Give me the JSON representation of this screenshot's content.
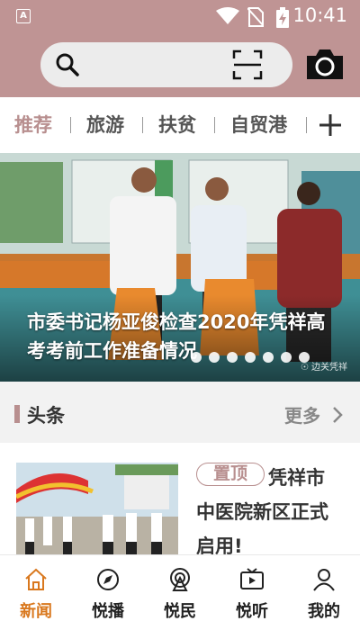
{
  "status_bar": {
    "time": "10:41",
    "app_indicator": "A"
  },
  "search": {
    "value": "",
    "placeholder": ""
  },
  "tabs": [
    {
      "label": "推荐",
      "active": true
    },
    {
      "label": "旅游",
      "active": false
    },
    {
      "label": "扶贫",
      "active": false
    },
    {
      "label": "自贸港",
      "active": false
    }
  ],
  "banner": {
    "caption": "市委书记杨亚俊检查2020年凭祥高考考前工作准备情况",
    "watermark": "☉ 边关凭祥",
    "dot_count": 7,
    "active_dot": 0
  },
  "section": {
    "title": "头条",
    "more_label": "更多"
  },
  "news": [
    {
      "badge": "置顶",
      "headline": "凭祥市中医院新区正式启用!"
    }
  ],
  "bottom_nav": [
    {
      "label": "新闻",
      "icon": "home-icon",
      "active": true
    },
    {
      "label": "悦播",
      "icon": "compass-icon",
      "active": false
    },
    {
      "label": "悦民",
      "icon": "broadcast-icon",
      "active": false
    },
    {
      "label": "悦听",
      "icon": "video-icon",
      "active": false
    },
    {
      "label": "我的",
      "icon": "user-icon",
      "active": false
    }
  ],
  "colors": {
    "header": "#bf9494",
    "accent": "#b88f8f",
    "nav_active": "#d9781e"
  }
}
